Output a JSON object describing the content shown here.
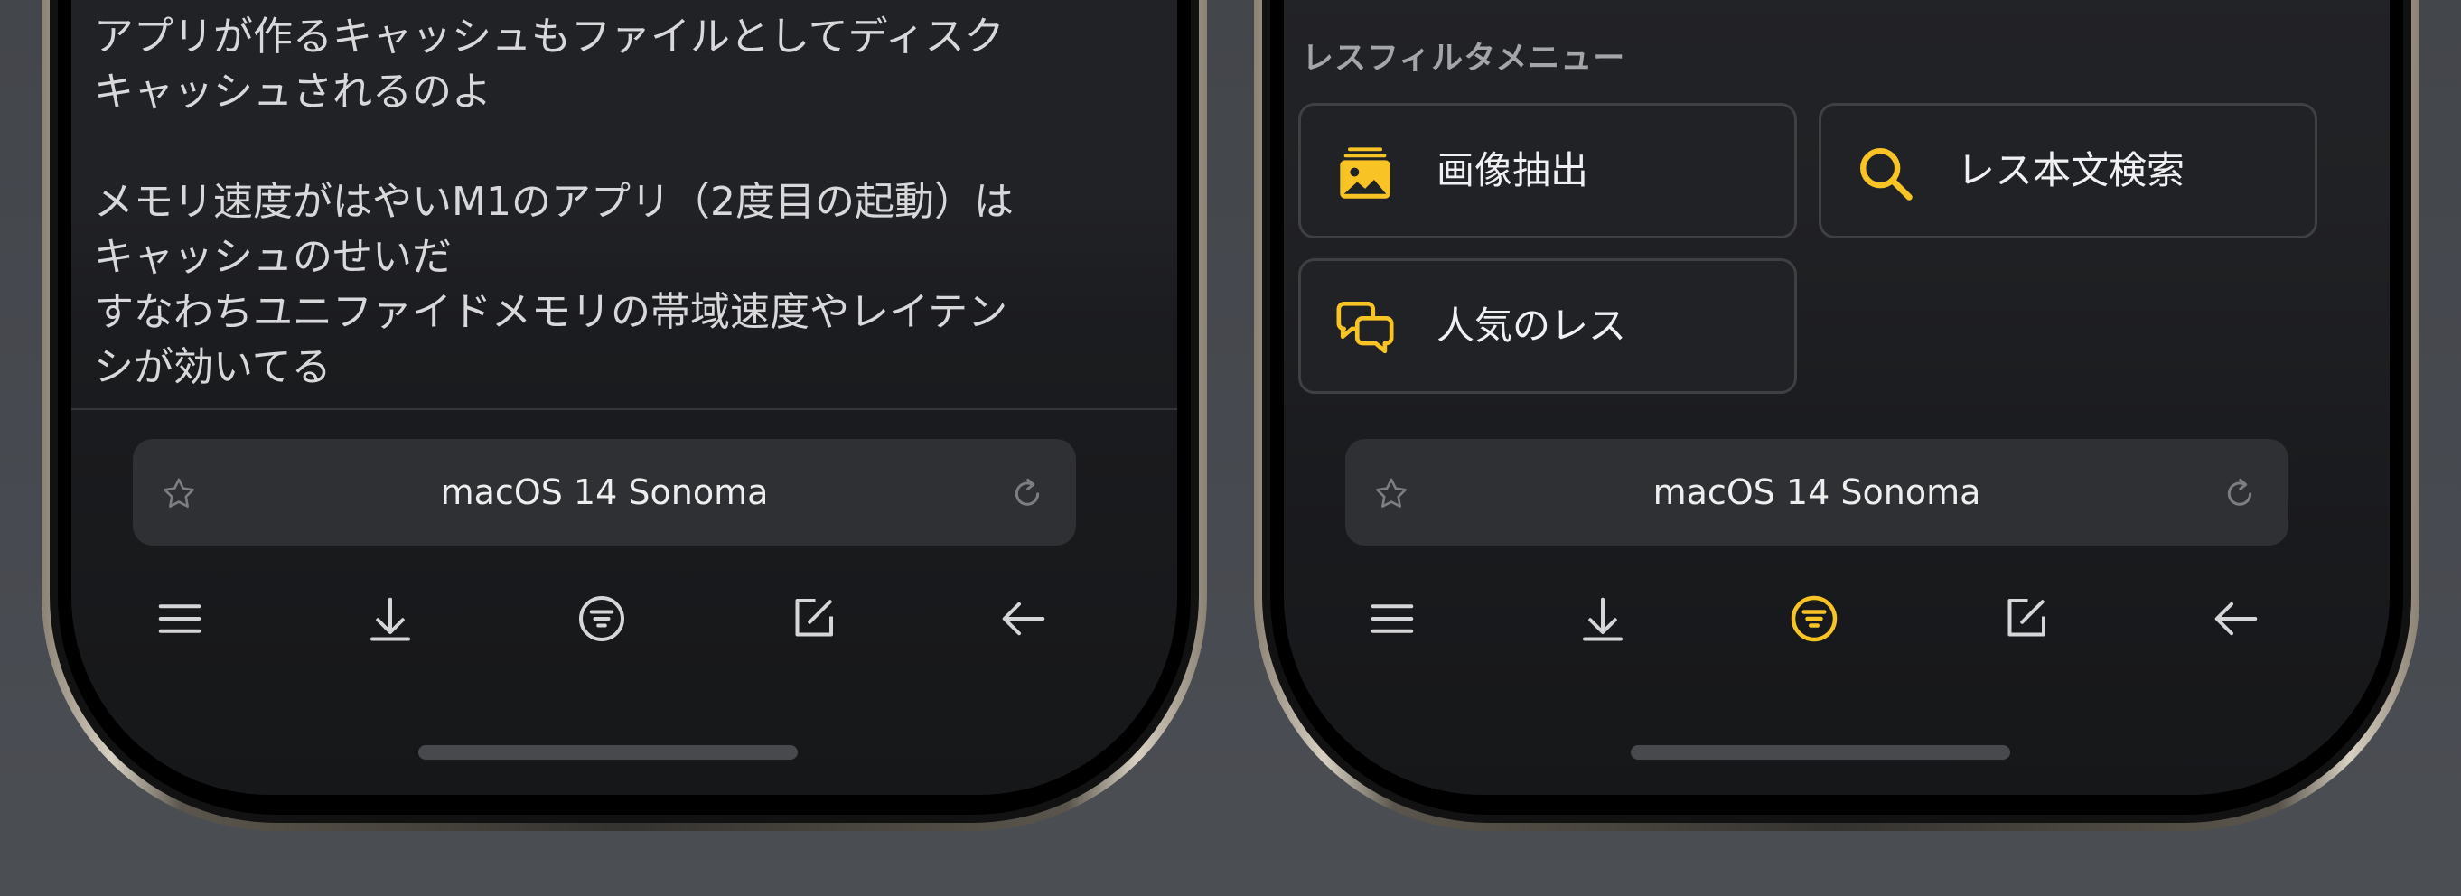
{
  "left_screen": {
    "post_paragraphs": [
      "アプリが作るキャッシュもファイルとしてディスク\nキャッシュされるのよ",
      "メモリ速度がはやいM1のアプリ（2度目の起動）は\nキャッシュのせいだ\nすなわちユニファイドメモリの帯域速度やレイテン\nシが効いてる"
    ],
    "address_bar": {
      "title": "macOS 14 Sonoma"
    },
    "toolbar_active": "none"
  },
  "right_screen": {
    "filter_menu": {
      "title": "レスフィルタメニュー",
      "buttons": [
        {
          "label": "画像抽出",
          "icon": "image-icon"
        },
        {
          "label": "レス本文検索",
          "icon": "search-icon"
        },
        {
          "label": "人気のレス",
          "icon": "chat-bubbles-icon"
        }
      ]
    },
    "address_bar": {
      "title": "macOS 14 Sonoma"
    },
    "toolbar_active": "filter"
  },
  "toolbar_icons": [
    "menu-icon",
    "download-icon",
    "filter-icon",
    "compose-icon",
    "back-arrow-icon"
  ],
  "colors": {
    "accent": "#f7c325",
    "icon_default": "#d6d6d8",
    "screen_bg": "#212226",
    "bar_bg": "#2e3034",
    "background": "#45484d"
  }
}
